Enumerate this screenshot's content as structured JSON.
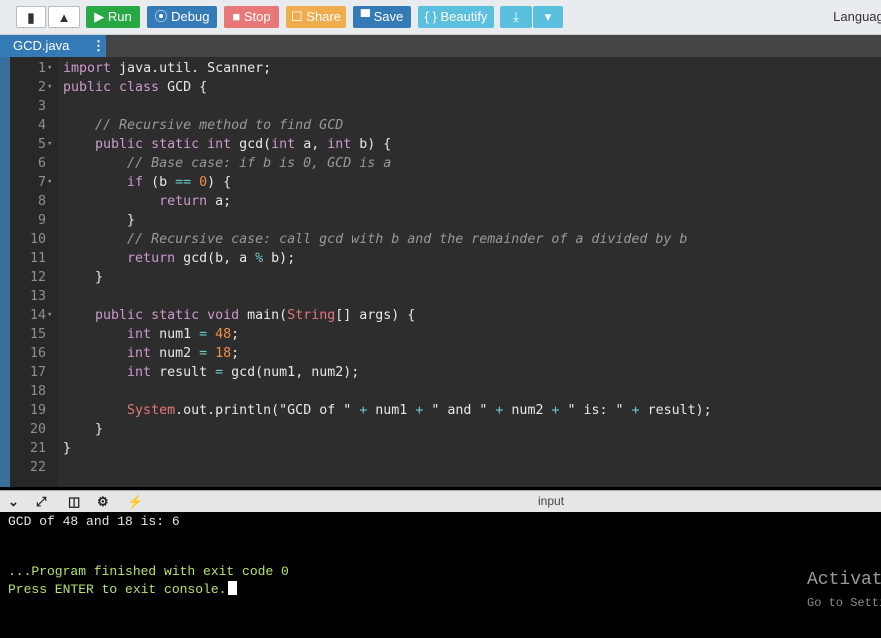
{
  "toolbar": {
    "new_file_icon": "file-icon",
    "upload_icon": "upload-icon",
    "run_label": "▶ Run",
    "debug_label": "⦿ Debug",
    "stop_label": "■ Stop",
    "share_label": "☐ Share",
    "save_label": "▀ Save",
    "beautify_label": "{ } Beautify",
    "download_icon": "download-icon",
    "dropdown_icon": "caret-down-icon",
    "language_label": "Language"
  },
  "tabs": {
    "file_name": "GCD.java",
    "menu_glyph": "⋮"
  },
  "editor": {
    "line_numbers": [
      "1",
      "2",
      "3",
      "4",
      "5",
      "6",
      "7",
      "8",
      "9",
      "10",
      "11",
      "12",
      "13",
      "14",
      "15",
      "16",
      "17",
      "18",
      "19",
      "20",
      "21",
      "22"
    ],
    "lines": [
      "import java.util. Scanner;",
      "public class GCD {",
      "",
      "    // Recursive method to find GCD",
      "    public static int gcd(int a, int b) {",
      "        // Base case: if b is 0, GCD is a",
      "        if (b == 0) {",
      "            return a;",
      "        }",
      "        // Recursive case: call gcd with b and the remainder of a divided by b",
      "        return gcd(b, a % b);",
      "    }",
      "",
      "    public static void main(String[] args) {",
      "        int num1 = 48;",
      "        int num2 = 18;",
      "        int result = gcd(num1, num2);",
      "",
      "        System.out.println(\"GCD of \" + num1 + \" and \" + num2 + \" is: \" + result);",
      "    }",
      "}",
      ""
    ]
  },
  "console": {
    "header_label": "input",
    "output_line1": "GCD of 48 and 18 is: 6",
    "finish_line": "...Program finished with exit code 0",
    "enter_line": "Press ENTER to exit console.",
    "watermark_title": "Activate",
    "watermark_sub": "Go to Settin"
  },
  "colors": {
    "run": "#28a745",
    "debug": "#337ab7",
    "stop": "#e87878",
    "share": "#f0ad4e",
    "save": "#337ab7",
    "beautify": "#5bc0de",
    "editor_bg": "#2d2d2d",
    "console_bg": "#000000",
    "console_green": "#b6e36b"
  }
}
